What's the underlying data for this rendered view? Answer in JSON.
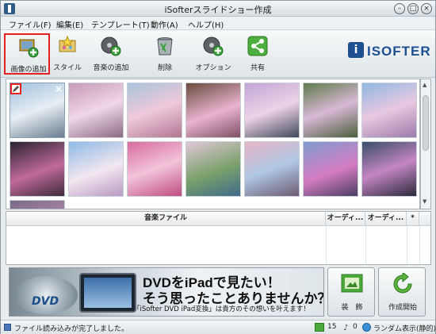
{
  "window": {
    "title": "iSofterスライドショー作成"
  },
  "menu": [
    {
      "label": "ファイル(F)"
    },
    {
      "label": "編集(E)"
    },
    {
      "label": "テンプレート(T)"
    },
    {
      "label": "動作(A)"
    },
    {
      "label": "ヘルプ(H)"
    }
  ],
  "toolbar": {
    "add_image": "画像の追加",
    "style": "スタイル",
    "add_music": "音楽の追加",
    "delete": "削除",
    "option": "オプション",
    "share": "共有",
    "logo": "ISOFTER",
    "logo_mark": "i"
  },
  "table": {
    "headers": [
      "音楽ファイル",
      "オーディ...",
      "オーディ...",
      "*"
    ]
  },
  "banner": {
    "line1": "DVDをiPadで見たい！",
    "line2": "そう思ったことありませんか？",
    "line3": "「iSofter DVD iPad変換」は貴方のその想いを叶えます！",
    "dvd_badge": "DVD"
  },
  "actions": {
    "decorate": "装　飾",
    "start": "作成開始"
  },
  "status": {
    "message": "ファイル読み込みが完了しました。",
    "photo_count": "15",
    "music_count": "0",
    "mode": "ランダム表示(静的)"
  }
}
